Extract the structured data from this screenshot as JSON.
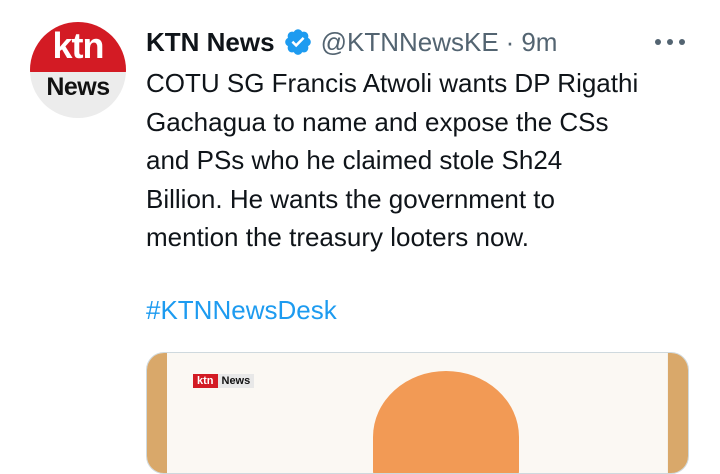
{
  "account": {
    "avatar_line1": "ktn",
    "avatar_line2": "News",
    "display_name": "KTN News",
    "handle": "@KTNNewsKE",
    "separator": "·",
    "time": "9m"
  },
  "tweet": {
    "lines": [
      "COTU SG Francis Atwoli wants DP Rigathi",
      "Gachagua to name and expose the CSs",
      "and PSs who he claimed stole Sh24",
      "Billion. He wants the government to",
      "mention the treasury looters now."
    ],
    "hashtag": "#KTNNewsDesk"
  },
  "media": {
    "logo_ktn": "ktn",
    "logo_news": "News"
  },
  "colors": {
    "link": "#1d9bf0",
    "verified": "#1d9bf0",
    "brand_red": "#d31b24",
    "muted": "#536471"
  },
  "icons": {
    "verified": "verified-badge-icon",
    "more": "more-horizontal-icon"
  }
}
